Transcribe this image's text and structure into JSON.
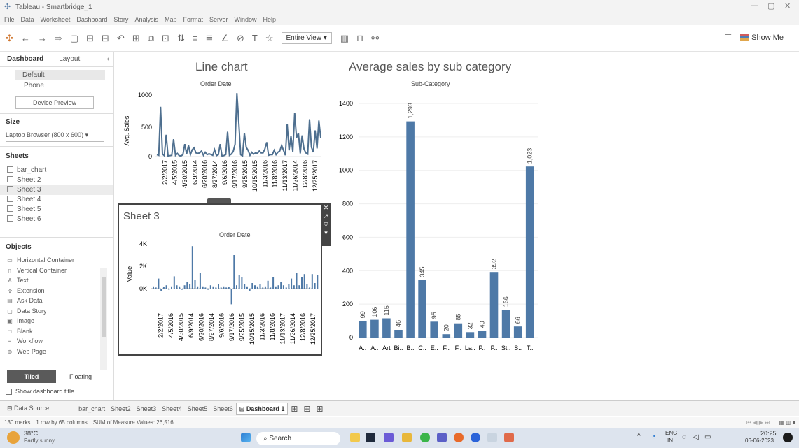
{
  "window": {
    "title": "Tableau - Smartbridge_1"
  },
  "menu": [
    "File",
    "Data",
    "Worksheet",
    "Dashboard",
    "Story",
    "Analysis",
    "Map",
    "Format",
    "Server",
    "Window",
    "Help"
  ],
  "toolbar": {
    "view_select": "Entire View",
    "show_me": "Show Me"
  },
  "left_panel": {
    "tab_dashboard": "Dashboard",
    "tab_layout": "Layout",
    "device_default": "Default",
    "device_phone": "Phone",
    "device_preview": "Device Preview",
    "size_header": "Size",
    "size_value": "Laptop Browser (800 x 600)",
    "sheets_header": "Sheets",
    "sheets": [
      "bar_chart",
      "Sheet 2",
      "Sheet 3",
      "Sheet 4",
      "Sheet 5",
      "Sheet 6"
    ],
    "objects_header": "Objects",
    "objects": [
      {
        "icon": "▭",
        "label": "Horizontal Container"
      },
      {
        "icon": "▯",
        "label": "Vertical Container"
      },
      {
        "icon": "A",
        "label": "Text"
      },
      {
        "icon": "✣",
        "label": "Extension"
      },
      {
        "icon": "▤",
        "label": "Ask Data"
      },
      {
        "icon": "▢",
        "label": "Data Story"
      },
      {
        "icon": "▣",
        "label": "Image"
      },
      {
        "icon": "□",
        "label": "Blank"
      },
      {
        "icon": "≡",
        "label": "Workflow"
      },
      {
        "icon": "⊕",
        "label": "Web Page"
      }
    ],
    "tiled": "Tiled",
    "floating": "Floating",
    "show_title": "Show dashboard title"
  },
  "line_chart": {
    "title": "Line chart",
    "header": "Order Date",
    "ylabel": "Avg. Sales",
    "yticks": [
      "1000",
      "500",
      "0"
    ],
    "xticks": [
      "2/2/2017",
      "4/5/2015",
      "4/30/2015",
      "6/9/2014",
      "6/20/2016",
      "8/27/2014",
      "9/6/2016",
      "9/17/2016",
      "9/25/2015",
      "10/15/2015",
      "11/3/2016",
      "11/8/2016",
      "11/13/2017",
      "11/26/2014",
      "12/8/2016",
      "12/25/2017"
    ]
  },
  "sheet3": {
    "title": "Sheet 3",
    "header": "Order Date",
    "ylabel": "Value",
    "yticks": [
      "4K",
      "2K",
      "0K"
    ],
    "xticks": [
      "2/2/2017",
      "4/5/2016",
      "4/30/2015",
      "6/9/2014",
      "6/20/2016",
      "8/27/2014",
      "9/6/2016",
      "9/17/2016",
      "9/25/2015",
      "10/15/2015",
      "11/3/2016",
      "11/8/2016",
      "11/13/2017",
      "11/26/2014",
      "12/8/2016",
      "12/25/2017"
    ]
  },
  "bar_chart": {
    "title": "Average sales by sub category",
    "header": "Sub-Category",
    "yticks": [
      "1400",
      "1200",
      "1000",
      "800",
      "600",
      "400",
      "200",
      "0"
    ],
    "categories": [
      "A..",
      "A..",
      "Art",
      "Bi..",
      "B..",
      "C..",
      "E..",
      "F..",
      "F..",
      "La..",
      "P..",
      "P..",
      "St..",
      "S..",
      "T.."
    ],
    "labels": [
      "99",
      "106",
      "115",
      "46",
      "1,293",
      "345",
      "95",
      "20",
      "85",
      "32",
      "40",
      "392",
      "166",
      "66",
      "1,023"
    ]
  },
  "chart_data": [
    {
      "type": "line",
      "title": "Line chart",
      "xlabel": "Order Date",
      "ylabel": "Avg. Sales",
      "ylim": [
        0,
        1000
      ],
      "values": [
        30,
        20,
        800,
        40,
        15,
        350,
        10,
        15,
        20,
        280,
        20,
        50,
        15,
        10,
        30,
        200,
        40,
        180,
        30,
        110,
        140,
        60,
        50,
        60,
        90,
        20,
        70,
        30,
        45,
        35,
        20,
        110,
        15,
        30,
        200,
        10,
        15,
        30,
        400,
        20,
        40,
        80,
        200,
        1020,
        550,
        30,
        10,
        380,
        150,
        100,
        20,
        70,
        40,
        60,
        50,
        90,
        60,
        60,
        120,
        230,
        20,
        30,
        30,
        100,
        30,
        70,
        90,
        180,
        100,
        20,
        520,
        100,
        330,
        80,
        700,
        300,
        380,
        50,
        340,
        120,
        60,
        40,
        600,
        150,
        70,
        420,
        130,
        580,
        300
      ]
    },
    {
      "type": "bar",
      "title": "Sheet 3",
      "xlabel": "Order Date",
      "ylabel": "Value",
      "ylim": [
        -1500,
        4000
      ],
      "values": [
        200,
        100,
        900,
        -200,
        150,
        300,
        -100,
        200,
        1100,
        300,
        200,
        -100,
        300,
        600,
        400,
        3800,
        800,
        200,
        1400,
        200,
        100,
        -100,
        300,
        200,
        100,
        400,
        100,
        200,
        100,
        150,
        -1400,
        3000,
        300,
        1200,
        1000,
        400,
        200,
        -200,
        500,
        300,
        200,
        400,
        100,
        200,
        700,
        100,
        1000,
        200,
        300,
        600,
        300,
        100,
        400,
        900,
        300,
        1400,
        300,
        1000,
        1300,
        400,
        100,
        1300,
        500,
        1200
      ]
    },
    {
      "type": "bar",
      "title": "Average sales by sub category",
      "xlabel": "Sub-Category",
      "ylabel": "Avg. Sales",
      "ylim": [
        0,
        1400
      ],
      "categories": [
        "A..",
        "A..",
        "Art",
        "Bi..",
        "B..",
        "C..",
        "E..",
        "F..",
        "F..",
        "La..",
        "P..",
        "P..",
        "St..",
        "S..",
        "T.."
      ],
      "values": [
        99,
        106,
        115,
        46,
        1293,
        345,
        95,
        20,
        85,
        32,
        40,
        392,
        166,
        66,
        1023
      ]
    }
  ],
  "bottom_tabs": [
    "Data Source",
    "bar_chart",
    "Sheet2",
    "Sheet3",
    "Sheet4",
    "Sheet5",
    "Sheet6",
    "Dashboard 1"
  ],
  "status": {
    "marks": "130 marks",
    "rows": "1 row by 65 columns",
    "sum": "SUM of Measure Values: 26,516"
  },
  "taskbar": {
    "weather_temp": "38°C",
    "weather_desc": "Partly sunny",
    "search": "Search",
    "lang1": "ENG",
    "lang2": "IN",
    "time": "20:25",
    "date": "06-06-2023"
  },
  "colors": {
    "bar": "#4e79a7",
    "accent_dark": "#444444"
  }
}
